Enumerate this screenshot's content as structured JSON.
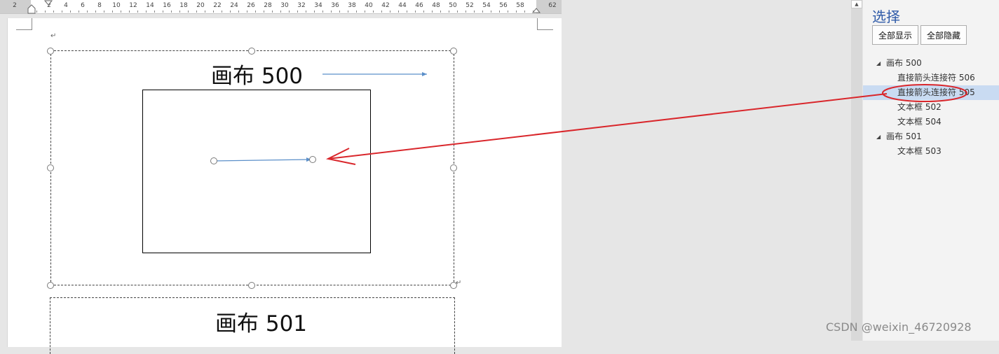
{
  "ruler": {
    "left_label": "2",
    "right_label": "62",
    "labels": [
      "2",
      "4",
      "6",
      "8",
      "10",
      "12",
      "14",
      "16",
      "18",
      "20",
      "22",
      "24",
      "26",
      "28",
      "30",
      "32",
      "34",
      "36",
      "38",
      "40",
      "42",
      "44",
      "46",
      "48",
      "50",
      "52",
      "54",
      "56",
      "58"
    ]
  },
  "document": {
    "paragraph_mark": "↵",
    "canvas500": {
      "title": "画布 500"
    },
    "canvas501": {
      "title": "画布 501"
    }
  },
  "pane": {
    "title": "选择",
    "show_all_label": "全部显示",
    "hide_all_label": "全部隐藏",
    "tree": [
      {
        "label": "画布 500",
        "level": 0,
        "expanded": true,
        "selected": false
      },
      {
        "label": "直接箭头连接符 506",
        "level": 1,
        "selected": false
      },
      {
        "label": "直接箭头连接符 505",
        "level": 1,
        "selected": true
      },
      {
        "label": "文本框 502",
        "level": 1,
        "selected": false
      },
      {
        "label": "文本框 504",
        "level": 1,
        "selected": false
      },
      {
        "label": "画布 501",
        "level": 0,
        "expanded": true,
        "selected": false
      },
      {
        "label": "文本框 503",
        "level": 1,
        "selected": false
      }
    ]
  },
  "watermark": "CSDN @weixin_46720928",
  "colors": {
    "accent_title": "#2e5aa8",
    "selection_bg": "#c9dbf2",
    "annotation_red": "#d9262b",
    "connector_blue": "#5b8fc9"
  },
  "icons": {
    "expand": "expand-triangle-icon",
    "scroll_up": "scroll-up-arrow-icon"
  }
}
